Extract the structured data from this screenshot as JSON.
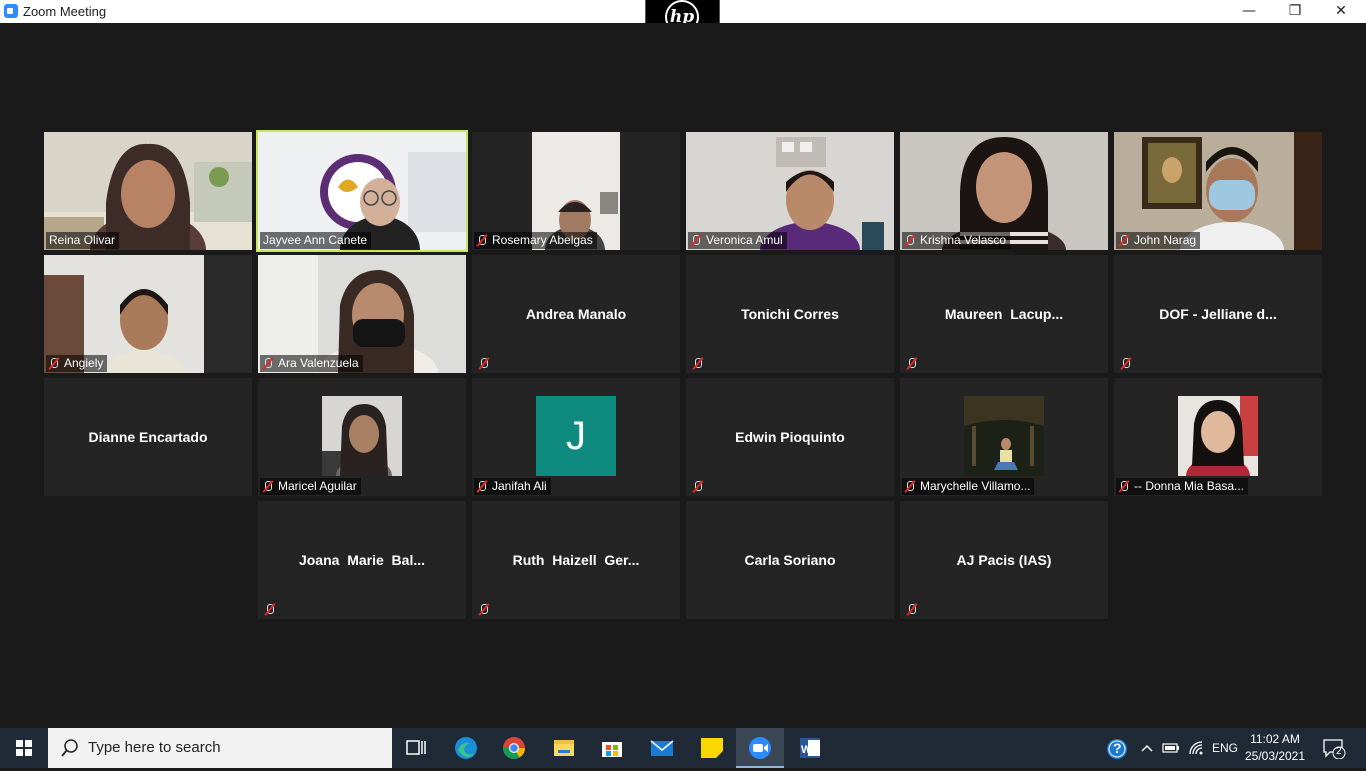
{
  "window": {
    "title": "Zoom Meeting",
    "controls": [
      "—",
      "❐",
      "✕"
    ]
  },
  "badge": {
    "logo_text": "hp"
  },
  "participants": {
    "row1": [
      {
        "name": "Reina Olivar",
        "muted": false
      },
      {
        "name": "Jayvee Ann Canete",
        "muted": false,
        "active_speaker": true
      },
      {
        "name": "Rosemary Abelgas",
        "muted": true
      },
      {
        "name": "Veronica Amul",
        "muted": true
      },
      {
        "name": "Krishna Velasco",
        "muted": true
      },
      {
        "name": "John Narag",
        "muted": true
      }
    ],
    "row2": [
      {
        "name": "Angiely",
        "muted": true
      },
      {
        "name": "Ara Valenzuela",
        "muted": true
      },
      {
        "name": "Andrea Manalo",
        "muted": true
      },
      {
        "name": "Tonichi Corres",
        "muted": true
      },
      {
        "name": "Maureen  Lacup...",
        "muted": true
      },
      {
        "name": "DOF - Jelliane d...",
        "muted": true
      }
    ],
    "row3": [
      {
        "name": "Dianne Encartado",
        "muted": false
      },
      {
        "name": "Maricel Aguilar",
        "muted": true
      },
      {
        "name": "Janifah Ali",
        "muted": true,
        "avatar_letter": "J"
      },
      {
        "name": "Edwin Pioquinto",
        "muted": true
      },
      {
        "name": "Marychelle Villamo...",
        "muted": true
      },
      {
        "name": "-- Donna Mia Basa...",
        "muted": true
      }
    ],
    "row4": [
      {
        "name": "Joana  Marie  Bal...",
        "muted": true
      },
      {
        "name": "Ruth  Haizell  Ger...",
        "muted": true
      },
      {
        "name": "Carla Soriano",
        "muted": false
      },
      {
        "name": "AJ Pacis (IAS)",
        "muted": true
      }
    ]
  },
  "taskbar": {
    "search_placeholder": "Type here to search",
    "apps": [
      "task-view",
      "edge",
      "chrome",
      "file-explorer",
      "store",
      "mail",
      "sticky-notes",
      "zoom",
      "word"
    ],
    "active_app": "zoom",
    "language": "ENG",
    "time": "11:02 AM",
    "date": "25/03/2021",
    "notification_count": "2",
    "help_glyph": "?"
  },
  "colors": {
    "meeting_bg": "#1a1a1a",
    "tile_bg": "#242424",
    "speaker_outline": "#c8e65a",
    "taskbar_bg": "#1f2a36",
    "avatar_teal": "#0e8a7e"
  }
}
